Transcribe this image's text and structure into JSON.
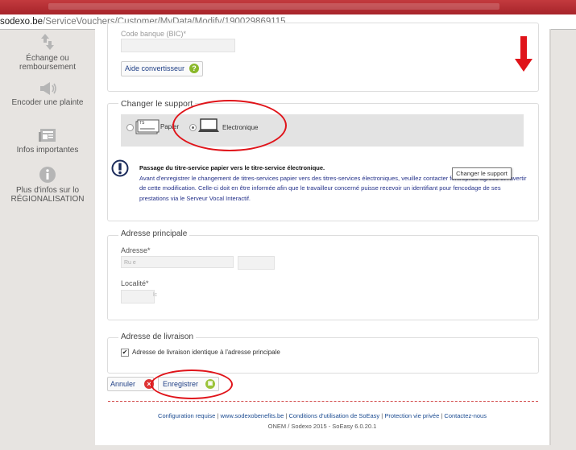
{
  "browser": {
    "url_host": "sodexo.be",
    "url_path": "/ServiceVouchers/Customer/MyData/Modify/190029869115"
  },
  "sidebar": {
    "items": [
      {
        "label": "Échange ou remboursement",
        "icon": "exchange-arrows-icon"
      },
      {
        "label": "Encoder une plainte",
        "icon": "megaphone-icon"
      },
      {
        "label": "Infos importantes",
        "icon": "newspaper-icon"
      },
      {
        "label": "Plus d'infos sur lo RÉGIONALISATION",
        "icon": "info-circle-icon"
      }
    ]
  },
  "bank": {
    "code_label": "Code banque (BIC)*",
    "converter_button": "Aide convertisseur"
  },
  "support": {
    "legend": "Changer le support",
    "option_paper": "Papier",
    "option_paper_card_text": "TS",
    "option_electronic": "Electronique",
    "selected": "Electronique",
    "info_title": "Passage du titre-service papier vers le titre-service électronique.",
    "info_body": "Avant d'enregistrer le changement de titres-services papier vers des titres-services électroniques, veuillez contacter fentreprise agréée et l'avertir de cette modification. Celle-ci doit en être informée afin que le travailleur concerné puisse recevoir un identifiant pour fencodage de ses prestations via le Serveur Vocal Interactif.",
    "tooltip": "Changer le support"
  },
  "address": {
    "legend": "Adresse principale",
    "street_label": "Adresse*",
    "street_value": "Ru          e",
    "city_label": "Localité*",
    "city_value": "    lc"
  },
  "delivery": {
    "legend": "Adresse de livraison",
    "checkbox_label": "Adresse de livraison identique à l'adresse principale",
    "checked": true
  },
  "actions": {
    "cancel": "Annuler",
    "save": "Enregistrer"
  },
  "footer": {
    "links": [
      "Configuration requise",
      "www.sodexobenefits.be",
      "Conditions d'utilisation de SoEasy",
      "Protection vie privée",
      "Contactez-nous"
    ],
    "version": "ONEM / Sodexo 2015 - SoEasy 6.0.20.1"
  },
  "colors": {
    "annotation_red": "#e0141a",
    "link_blue": "#1f3f86",
    "help_green": "#8ab82a",
    "cancel_red": "#d33",
    "save_green": "#9bc33a"
  }
}
